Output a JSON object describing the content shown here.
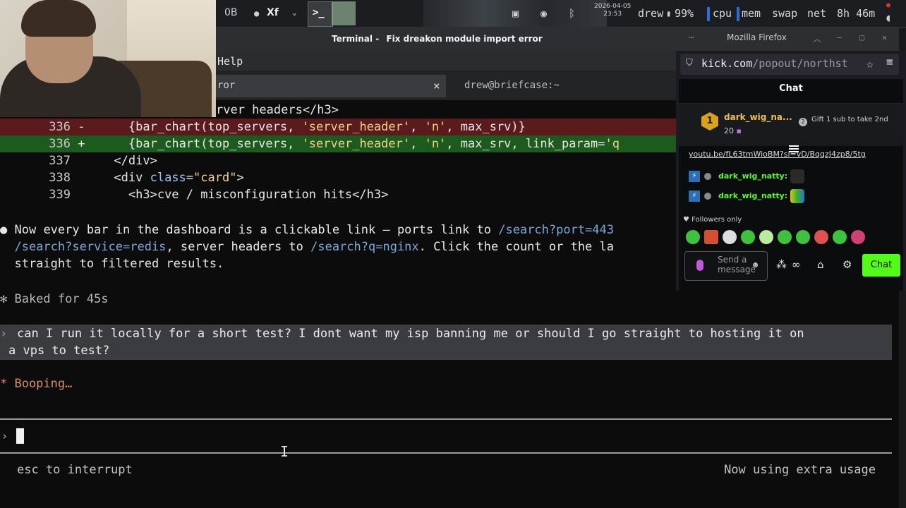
{
  "panel": {
    "task_hidden_label": "0B",
    "task_app_label": "Xf",
    "clock_date": "2026-04-05",
    "clock_time": "23:53",
    "user": "drew",
    "battery": "99%",
    "monitors": [
      "cpu",
      "mem",
      "swap",
      "net"
    ],
    "uptime": "8h 46m"
  },
  "window": {
    "terminal_title": "Terminal -",
    "terminal_subtitle": "Fix dreakon module import error",
    "firefox_title": "Mozilla Firefox"
  },
  "terminal": {
    "menu_help": "Help",
    "tabs": [
      {
        "label": "ror",
        "close": "×"
      },
      {
        "label": "drew@briefcase:~"
      }
    ],
    "diff": {
      "partial_line": "rver headers</h3>",
      "del_num": "336",
      "del_mark": "-",
      "del_code_a": "{bar_chart(top_servers, ",
      "del_str1": "'server_header'",
      "del_code_b": ", ",
      "del_str2": "'n'",
      "del_code_c": ", max_srv)}",
      "add_num": "336",
      "add_mark": "+",
      "add_code_a": "{bar_chart(top_servers, ",
      "add_str1": "'server_header'",
      "add_code_b": ", ",
      "add_str2": "'n'",
      "add_code_c": ", max_srv, link_param=",
      "add_str3": "'q",
      "l337_num": "337",
      "l337_code": "</div>",
      "l338_num": "338",
      "l338_code_a": "<div ",
      "l338_attr": "class",
      "l338_eq": "=",
      "l338_str": "\"card\"",
      "l338_end": ">",
      "l339_num": "339",
      "l339_code": "<h3>cve / misconfiguration hits</h3>"
    },
    "response": {
      "bullet": "●",
      "l1_text": "Now every bar in the dashboard is a clickable link — ports link to ",
      "l1_link": "/search?port=443",
      "l2_link1": "/search?service=redis",
      "l2_mid": ", server headers to ",
      "l2_link2": "/search?q=nginx",
      "l2_end": ". Click the count or the la",
      "l3_text": "straight to filtered results."
    },
    "baked": "✻ Baked for 45s",
    "user_prompt_l1": "can I run it locally for a short test? I dont want my isp banning me or should I go straight to hosting it on",
    "user_prompt_l2": "a vps to test?",
    "user_prompt_caret": "›",
    "booping": "* Booping…",
    "input_caret": "›",
    "status_left": "esc to interrupt",
    "status_right": "Now using extra usage"
  },
  "firefox": {
    "url_host": "kick.com",
    "url_path": "/popout/northst",
    "chat": {
      "heading": "Chat",
      "pinned_rank": "1",
      "pinned_user": "dark_wig_na...",
      "pinned_count": "20",
      "gift_text": "Gift 1 sub to take 2nd",
      "link": "youtu.be/fL63tmWioBM?si=vD/BqqzJ4zp8/5tg",
      "messages": [
        {
          "user": "dark_wig_natty:"
        },
        {
          "user": "dark_wig_natty:"
        }
      ],
      "followers_only": "Followers only",
      "input_placeholder": "Send a message",
      "send_button": "Chat"
    }
  },
  "colors": {
    "kick_green": "#53fc18",
    "diff_del": "#5b1a1c",
    "diff_add": "#1d5a1e",
    "booping": "#d98f6a"
  }
}
